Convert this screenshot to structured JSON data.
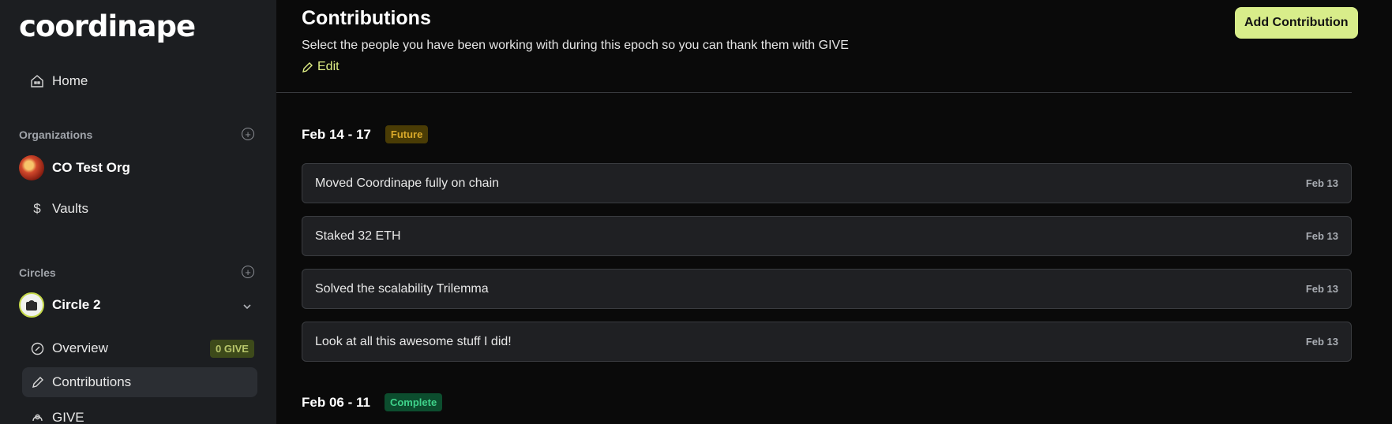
{
  "sidebar": {
    "logo": "coordinape",
    "home": "Home",
    "organizations_title": "Organizations",
    "org_name": "CO Test Org",
    "vaults": "Vaults",
    "circles_title": "Circles",
    "circle_name": "Circle 2",
    "overview": "Overview",
    "overview_badge": "0 GIVE",
    "contributions": "Contributions",
    "give": "GIVE"
  },
  "header": {
    "title": "Contributions",
    "subtitle": "Select the people you have been working with during this epoch so you can thank them with GIVE",
    "edit": "Edit",
    "add_button": "Add Contribution"
  },
  "epochs": [
    {
      "date": "Feb 14 - 17",
      "status": "Future",
      "items": [
        {
          "text": "Moved Coordinape fully on chain",
          "date": "Feb 13"
        },
        {
          "text": "Staked 32 ETH",
          "date": "Feb 13"
        },
        {
          "text": "Solved the scalability Trilemma",
          "date": "Feb 13"
        },
        {
          "text": "Look at all this awesome stuff I did!",
          "date": "Feb 13"
        }
      ]
    },
    {
      "date": "Feb 06 - 11",
      "status": "Complete",
      "items": []
    }
  ],
  "colors": {
    "accent": "#d8ed8a",
    "future_badge": "#4a3c05",
    "complete_badge": "#0c4d2e",
    "sidebar_bg": "#1c1e21",
    "main_bg": "#0a0a0a"
  }
}
